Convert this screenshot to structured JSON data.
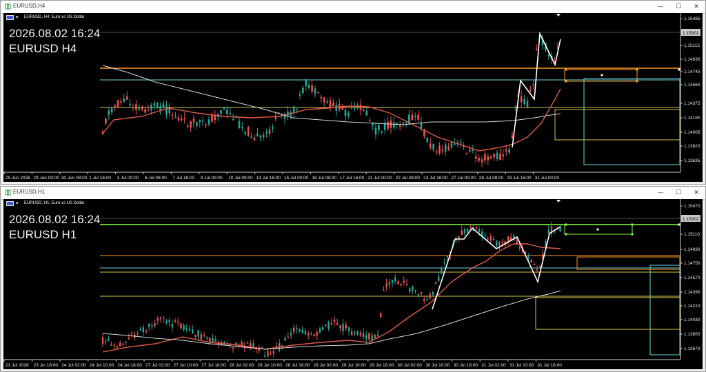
{
  "windows": [
    {
      "title": "EURUSD,H4",
      "symbol_desc": "EURUSD, H4:  Euro vs US Dollar",
      "overlay_datetime": "2026.08.02 16:24",
      "overlay_symbol": "EURUSD H4",
      "current_price": "1.15302",
      "price_labels": [
        "1.15485",
        "1.15302",
        "1.15115",
        "1.14930",
        "1.14745",
        "1.14560",
        "1.14375",
        "1.14190",
        "1.14005",
        "1.13820",
        "1.13635"
      ],
      "time_labels": [
        "25 Jun 2026",
        "29 Jun 00:00",
        "30 Jun 08:00",
        "1 Jul 16:00",
        "3 Jul 00:00",
        "6 Jul 08:00",
        "7 Jul 16:00",
        "9 Jul 00:00",
        "10 Jul 08:00",
        "13 Jul 16:00",
        "15 Jul 00:00",
        "16 Jul 08:00",
        "17 Jul 16:00",
        "21 Jul 00:00",
        "22 Jul 08:00",
        "23 Jul 16:00",
        "27 Jul 00:00",
        "28 Jul 08:00",
        "29 Jul 16:00",
        "31 Jul 00:00"
      ]
    },
    {
      "title": "EURUSD,H1",
      "symbol_desc": "EURUSD, H1:  Euro vs US Dollar",
      "overlay_datetime": "2026.08.02 16:24",
      "overlay_symbol": "EURUSD H1",
      "current_price": "1.15302",
      "price_labels": [
        "1.15470",
        "1.15302",
        "1.15110",
        "1.14930",
        "1.14750",
        "1.14570",
        "1.14390",
        "1.14210",
        "1.14030",
        "1.13850",
        "1.13670"
      ],
      "time_labels": [
        "23 Jul 2026",
        "23 Jul 18:00",
        "24 Jul 02:00",
        "24 Jul 10:00",
        "24 Jul 18:00",
        "27 Jul 02:00",
        "27 Jul 10:00",
        "27 Jul 18:00",
        "28 Jul 02:00",
        "28 Jul 10:00",
        "28 Jul 18:00",
        "29 Jul 02:00",
        "29 Jul 10:00",
        "29 Jul 18:00",
        "30 Jul 02:00",
        "30 Jul 10:00",
        "30 Jul 18:00",
        "31 Jul 02:00",
        "31 Jul 10:00",
        "31 Jul 18:00"
      ]
    }
  ],
  "colors": {
    "bull": "#26a69a",
    "bear": "#ef5350",
    "ma_fast": "#e05a4a",
    "ma_slow": "#d8d8d8",
    "zigzag": "#ffffff",
    "level_orange": "#ff9a1f",
    "level_cyan": "#6fd6e0",
    "level_yellow": "#d9c84a",
    "level_green": "#8cff3a"
  }
}
